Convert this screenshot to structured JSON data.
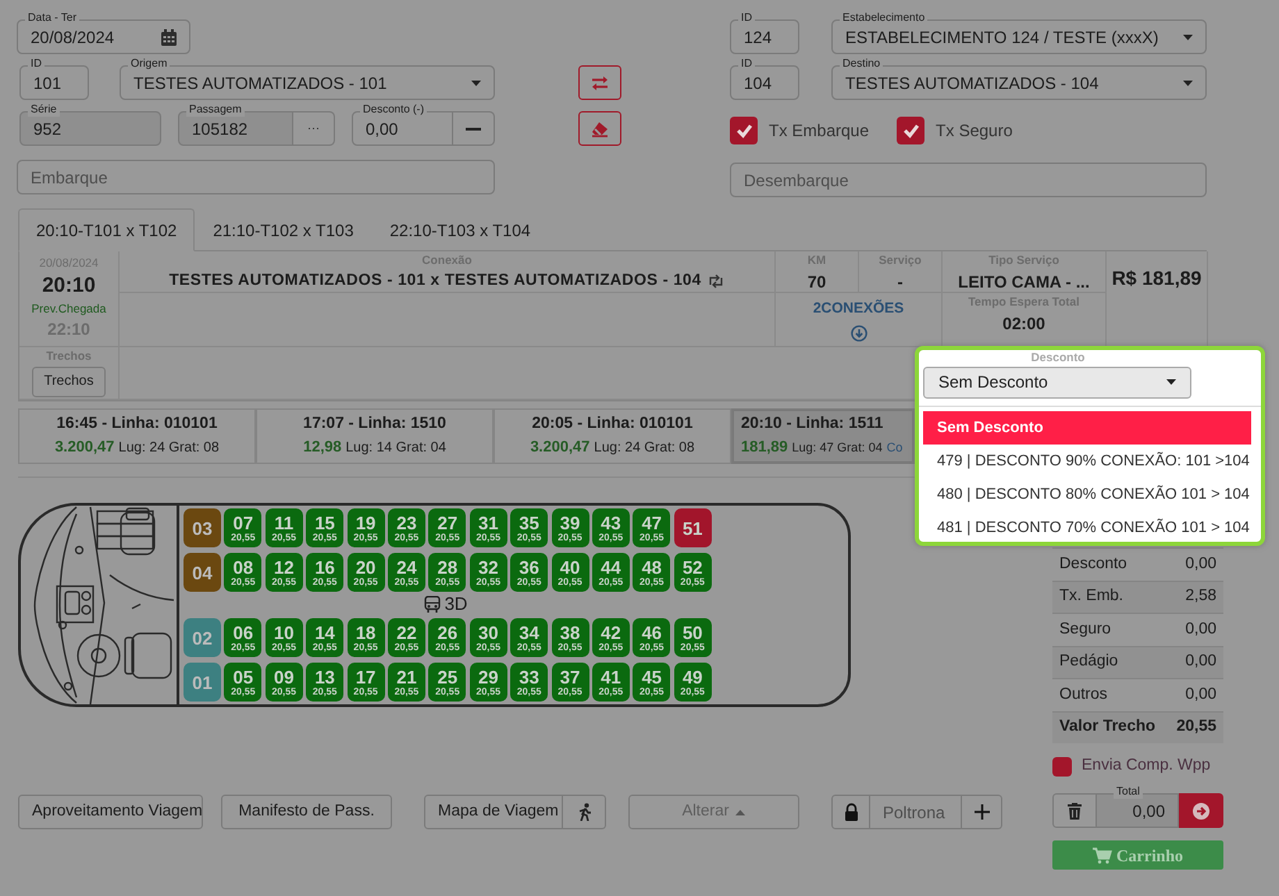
{
  "date_field": {
    "label": "Data - Ter",
    "value": "20/08/2024"
  },
  "origin": {
    "id_label": "ID",
    "id": "101",
    "label": "Origem",
    "value": "TESTES AUTOMATIZADOS - 101"
  },
  "serie": {
    "label": "Série",
    "value": "952"
  },
  "passagem": {
    "label": "Passagem",
    "value": "105182",
    "button": "···"
  },
  "discount_field": {
    "label": "Desconto (-)",
    "value": "0,00"
  },
  "embarque": {
    "placeholder": "Embarque"
  },
  "establishment": {
    "id_label": "ID",
    "id": "124",
    "label": "Estabelecimento",
    "value": "ESTABELECIMENTO 124 / TESTE (xxxX)"
  },
  "destination": {
    "id_label": "ID",
    "id": "104",
    "label": "Destino",
    "value": "TESTES AUTOMATIZADOS - 104"
  },
  "fees": [
    {
      "label": "Tx Embarque",
      "checked": true
    },
    {
      "label": "Tx Seguro",
      "checked": true
    }
  ],
  "desembarque": {
    "placeholder": "Desembarque"
  },
  "tabs": [
    {
      "label": "20:10-T101 x T102",
      "selected": true
    },
    {
      "label": "21:10-T102 x T103",
      "selected": false
    },
    {
      "label": "22:10-T103 x T104",
      "selected": false
    }
  ],
  "trip": {
    "date": "20/08/2024",
    "departure": "20:10",
    "arrival_label": "Prev.Chegada",
    "arrival": "22:10",
    "connection_label": "Conexão",
    "connection": "TESTES AUTOMATIZADOS - 101 x TESTES AUTOMATIZADOS - 104",
    "km_label": "KM",
    "km": "70",
    "service_label": "Serviço",
    "service": "-",
    "type_label": "Tipo Serviço",
    "type": "LEITO CAMA - ...",
    "connections": "2CONEXÕES",
    "wait_label": "Tempo Espera Total",
    "wait": "02:00",
    "price": "R$ 181,89",
    "segments_label": "Trechos",
    "segments_button": "Trechos"
  },
  "departures": [
    {
      "title": "16:45 - Linha: 010101",
      "fare": "3.200,47",
      "info": "Lug: 24 Grat: 08",
      "selected": false
    },
    {
      "title": "17:07 - Linha: 1510",
      "fare": "12,98",
      "info": "Lug: 14 Grat: 04",
      "selected": false
    },
    {
      "title": "20:05 - Linha: 010101",
      "fare": "3.200,47",
      "info": "Lug: 24 Grat: 08",
      "selected": false
    },
    {
      "title": "20:10 - Linha: 1511",
      "fare": "181,89",
      "info": "Lug: 47 Grat: 04",
      "extra": "Co",
      "selected": true
    }
  ],
  "discount_popup": {
    "label": "Desconto",
    "value": "Sem Desconto",
    "options": [
      {
        "text": "Sem Desconto",
        "selected": true
      },
      {
        "text": "479 | DESCONTO 90% CONEXÃO: 101 >104",
        "selected": false
      },
      {
        "text": "480 | DESCONTO 80% CONEXÃO 101 > 104",
        "selected": false
      },
      {
        "text": "481 | DESCONTO 70% CONEXÃO 101 > 104",
        "selected": false
      }
    ]
  },
  "seat_map": {
    "deck": "3D",
    "rows": [
      {
        "label": "03",
        "color": "#6b4810",
        "seats": [
          {
            "number": "07",
            "price": "20,55",
            "occupied": false
          },
          {
            "number": "11",
            "price": "20,55",
            "occupied": false
          },
          {
            "number": "15",
            "price": "20,55",
            "occupied": false
          },
          {
            "number": "19",
            "price": "20,55",
            "occupied": false
          },
          {
            "number": "23",
            "price": "20,55",
            "occupied": false
          },
          {
            "number": "27",
            "price": "20,55",
            "occupied": false
          },
          {
            "number": "31",
            "price": "20,55",
            "occupied": false
          },
          {
            "number": "35",
            "price": "20,55",
            "occupied": false
          },
          {
            "number": "39",
            "price": "20,55",
            "occupied": false
          },
          {
            "number": "43",
            "price": "20,55",
            "occupied": false
          },
          {
            "number": "47",
            "price": "20,55",
            "occupied": false
          },
          {
            "number": "51",
            "occupied": true
          }
        ]
      },
      {
        "label": "04",
        "color": "#6b4810",
        "seats": [
          {
            "number": "08",
            "price": "20,55",
            "occupied": false
          },
          {
            "number": "12",
            "price": "20,55",
            "occupied": false
          },
          {
            "number": "16",
            "price": "20,55",
            "occupied": false
          },
          {
            "number": "20",
            "price": "20,55",
            "occupied": false
          },
          {
            "number": "24",
            "price": "20,55",
            "occupied": false
          },
          {
            "number": "28",
            "price": "20,55",
            "occupied": false
          },
          {
            "number": "32",
            "price": "20,55",
            "occupied": false
          },
          {
            "number": "36",
            "price": "20,55",
            "occupied": false
          },
          {
            "number": "40",
            "price": "20,55",
            "occupied": false
          },
          {
            "number": "44",
            "price": "20,55",
            "occupied": false
          },
          {
            "number": "48",
            "price": "20,55",
            "occupied": false
          },
          {
            "number": "52",
            "price": "20,55",
            "occupied": false
          }
        ]
      },
      {
        "label": "02",
        "color": "#3d8081",
        "seats": [
          {
            "number": "06",
            "price": "20,55",
            "occupied": false
          },
          {
            "number": "10",
            "price": "20,55",
            "occupied": false
          },
          {
            "number": "14",
            "price": "20,55",
            "occupied": false
          },
          {
            "number": "18",
            "price": "20,55",
            "occupied": false
          },
          {
            "number": "22",
            "price": "20,55",
            "occupied": false
          },
          {
            "number": "26",
            "price": "20,55",
            "occupied": false
          },
          {
            "number": "30",
            "price": "20,55",
            "occupied": false
          },
          {
            "number": "34",
            "price": "20,55",
            "occupied": false
          },
          {
            "number": "38",
            "price": "20,55",
            "occupied": false
          },
          {
            "number": "42",
            "price": "20,55",
            "occupied": false
          },
          {
            "number": "46",
            "price": "20,55",
            "occupied": false
          },
          {
            "number": "50",
            "price": "20,55",
            "occupied": false
          }
        ]
      },
      {
        "label": "01",
        "color": "#3d8081",
        "seats": [
          {
            "number": "05",
            "price": "20,55",
            "occupied": false
          },
          {
            "number": "09",
            "price": "20,55",
            "occupied": false
          },
          {
            "number": "13",
            "price": "20,55",
            "occupied": false
          },
          {
            "number": "17",
            "price": "20,55",
            "occupied": false
          },
          {
            "number": "21",
            "price": "20,55",
            "occupied": false
          },
          {
            "number": "25",
            "price": "20,55",
            "occupied": false
          },
          {
            "number": "29",
            "price": "20,55",
            "occupied": false
          },
          {
            "number": "33",
            "price": "20,55",
            "occupied": false
          },
          {
            "number": "37",
            "price": "20,55",
            "occupied": false
          },
          {
            "number": "41",
            "price": "20,55",
            "occupied": false
          },
          {
            "number": "45",
            "price": "20,55",
            "occupied": false
          },
          {
            "number": "49",
            "price": "20,55",
            "occupied": false
          }
        ]
      }
    ]
  },
  "summary": [
    {
      "label": "Desconto",
      "value": "0,00",
      "kind": "line"
    },
    {
      "label": "Tx. Emb.",
      "value": "2,58",
      "kind": "line"
    },
    {
      "label": "Seguro",
      "value": "0,00",
      "kind": "line"
    },
    {
      "label": "Pedágio",
      "value": "0,00",
      "kind": "line"
    },
    {
      "label": "Outros",
      "value": "0,00",
      "kind": "line"
    },
    {
      "label": "Valor Trecho",
      "value": "20,55",
      "kind": "total"
    }
  ],
  "whatsapp": {
    "label": "Envia Comp. Wpp",
    "checked": false
  },
  "actions": [
    {
      "label": "Aproveitamento Viagem"
    },
    {
      "label": "Manifesto de Pass."
    },
    {
      "label": "Mapa de Viagem"
    }
  ],
  "alterar": {
    "label": "Alterar",
    "disabled": true
  },
  "seat_input": {
    "placeholder": "Poltrona"
  },
  "total": {
    "label": "Total",
    "value": "0,00"
  },
  "cart_button": "Carrinho"
}
